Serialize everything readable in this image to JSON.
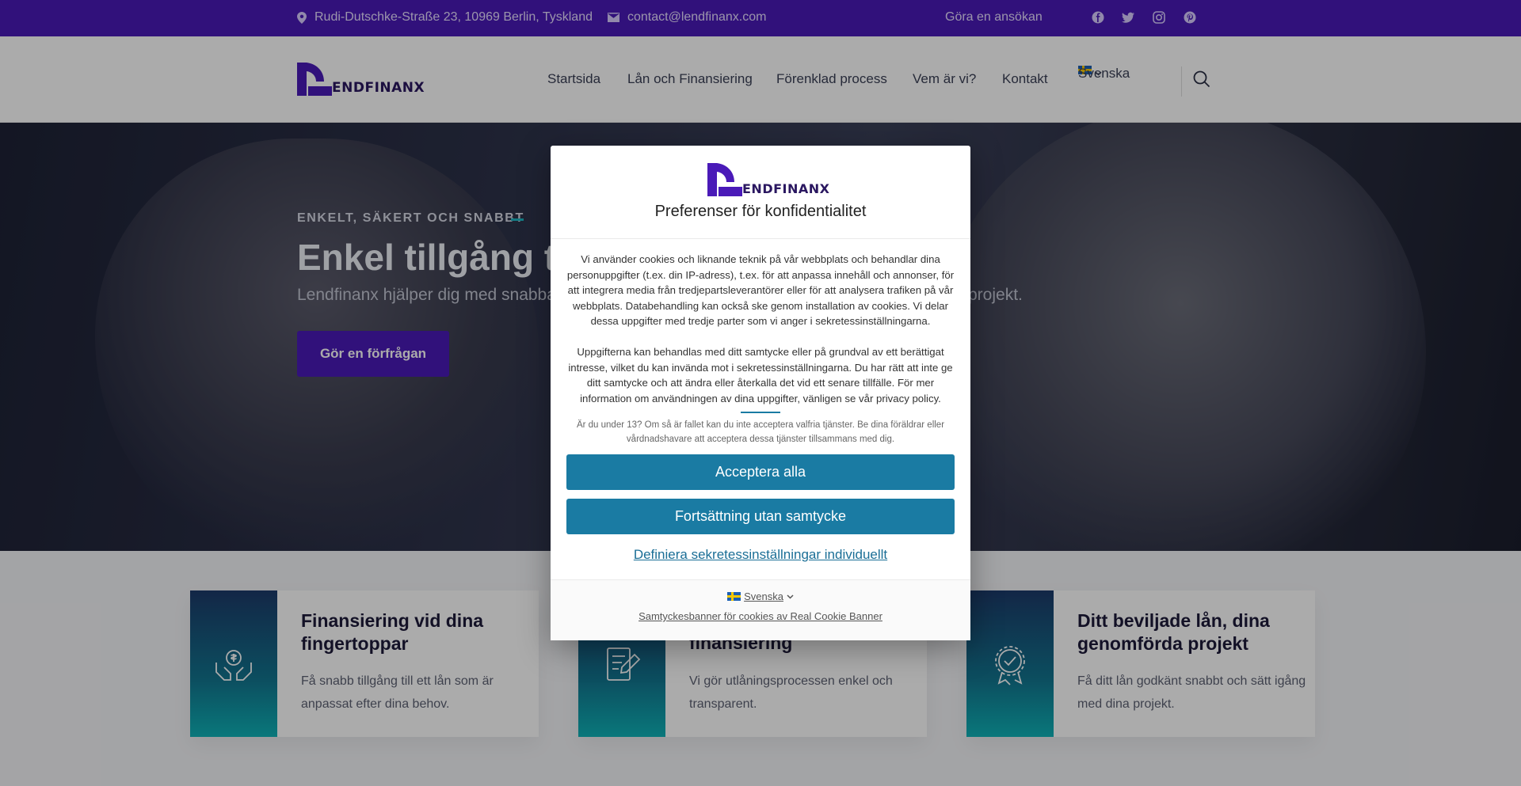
{
  "colors": {
    "brand_purple": "#4a1ab8",
    "consent_blue": "#1a7ba3",
    "teal": "#0fb3b8"
  },
  "topbar": {
    "address": "Rudi-Dutschke-Straße 23, 10969 Berlin, Tyskland",
    "email": "contact@lendfinanx.com",
    "apply_link": "Göra en ansökan",
    "social_icons": [
      "facebook-icon",
      "twitter-icon",
      "instagram-icon",
      "pinterest-icon"
    ]
  },
  "header": {
    "logo_text": "ENDFINANX",
    "nav": [
      "Startsida",
      "Lån och Finansiering",
      "Förenklad process",
      "Vem är vi?",
      "Kontakt"
    ],
    "language": "Svenska"
  },
  "hero": {
    "tagline": "ENKELT, SÄKERT OCH SNABBT",
    "title": "Enkel tillgång till",
    "subtitle": "Lendfinanx hjälper dig med snabba",
    "subtitle_tail": "projekt.",
    "cta": "Gör en förfrågan"
  },
  "features": [
    {
      "icon": "money-hands-icon",
      "title": "Finansiering vid dina fingertoppar",
      "text": "Få snabb tillgång till ett lån som är anpassat efter dina behov."
    },
    {
      "icon": "document-pen-icon",
      "title": "finansiering",
      "text": "Vi gör utlåningsprocessen enkel och transparent."
    },
    {
      "icon": "award-badge-icon",
      "title": "Ditt beviljade lån, dina genomförda projekt",
      "text": "Få ditt lån godkänt snabbt och sätt igång med dina projekt."
    }
  ],
  "consent": {
    "logo_text": "ENDFINANX",
    "title": "Preferenser för konfidentialitet",
    "paragraph1": "Vi använder cookies och liknande teknik på vår webbplats och behandlar dina personuppgifter (t.ex. din IP-adress), t.ex. för att anpassa innehåll och annonser, för att integrera media från tredjepartsleverantörer eller för att analysera trafiken på vår webbplats. Databehandling kan också ske genom installation av cookies. Vi delar dessa uppgifter med tredje parter som vi anger i sekretessinställningarna.",
    "paragraph2": "Uppgifterna kan behandlas med ditt samtycke eller på grundval av ett berättigat intresse, vilket du kan invända mot i sekretessinställningarna. Du har rätt att inte ge ditt samtycke och att ändra eller återkalla det vid ett senare tillfälle. För mer information om användningen av dina uppgifter, vänligen se vår privacy policy.",
    "age_notice": "Är du under 13? Om så är fallet kan du inte acceptera valfria tjänster. Be dina föräldrar eller vårdnadshavare att acceptera dessa tjänster tillsammans med dig.",
    "accept_all": "Acceptera alla",
    "continue_without": "Fortsättning utan samtycke",
    "customize": "Definiera sekretessinställningar individuellt",
    "language": "Svenska",
    "powered_by": "Samtyckesbanner för cookies av Real Cookie Banner"
  }
}
